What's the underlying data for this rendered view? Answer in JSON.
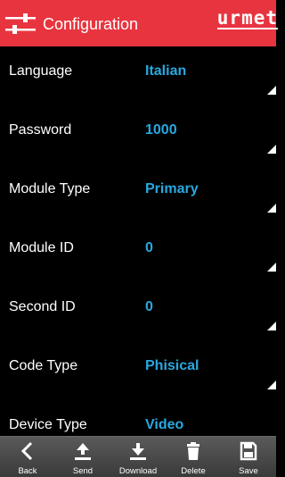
{
  "header": {
    "title": "Configuration",
    "brand": "urmet",
    "icon": "settings-sliders-icon",
    "color": "#e8343f"
  },
  "rows": [
    {
      "label": "Language",
      "value": "Italian"
    },
    {
      "label": "Password",
      "value": "1000"
    },
    {
      "label": "Module Type",
      "value": "Primary"
    },
    {
      "label": "Module ID",
      "value": "0"
    },
    {
      "label": "Second ID",
      "value": "0"
    },
    {
      "label": "Code Type",
      "value": "Phisical"
    },
    {
      "label": "Device Type",
      "value": "Video"
    }
  ],
  "value_color": "#29a8e0",
  "toolbar": {
    "back_label": "Back",
    "send_label": "Send",
    "download_label": "Download",
    "delete_label": "Delete",
    "save_label": "Save"
  }
}
